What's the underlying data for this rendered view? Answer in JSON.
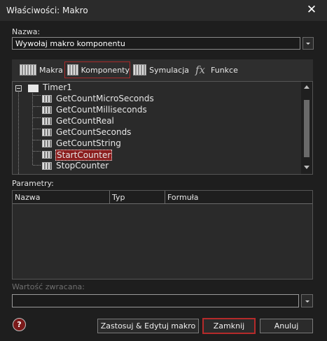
{
  "window": {
    "title": "Właściwości: Makro",
    "close_icon": "close-icon"
  },
  "name_field": {
    "label": "Nazwa:",
    "value": "Wywołaj makro komponentu"
  },
  "tabs": [
    {
      "label": "Makra",
      "icon": "macro-icon"
    },
    {
      "label": "Komponenty",
      "icon": "component-icon",
      "active": true
    },
    {
      "label": "Symulacja",
      "icon": "simulation-icon"
    },
    {
      "label": "Funkce",
      "icon": "function-icon",
      "glyph": "fx"
    }
  ],
  "tree": {
    "root": "Timer1",
    "items": [
      "GetCountMicroSeconds",
      "GetCountMilliseconds",
      "GetCountReal",
      "GetCountSeconds",
      "GetCountString",
      "StartCounter",
      "StopCounter"
    ],
    "selected": "StartCounter"
  },
  "params": {
    "label": "Parametry:",
    "columns": [
      "Nazwa",
      "Typ",
      "Formuła"
    ]
  },
  "return_value": {
    "label": "Wartość zwracana:",
    "value": ""
  },
  "buttons": {
    "apply_edit": "Zastosuj & Edytuj makro",
    "close": "Zamknij",
    "cancel": "Anuluj",
    "help": "?"
  },
  "colors": {
    "background": "#1e1e1e",
    "accent": "#b52a2a",
    "selection": "#8b1e1e"
  }
}
